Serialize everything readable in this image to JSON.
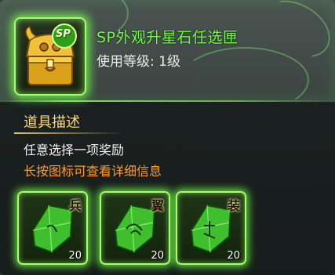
{
  "item": {
    "icon": "treasure-chest-sp-icon",
    "icon_badge": "SP",
    "name": "SP外观升星石任选匣",
    "level_text": "使用等级: 1级"
  },
  "description": {
    "section_title": "道具描述",
    "text": "任意选择一项奖励",
    "hint": "长按图标可查看详细信息"
  },
  "rewards": [
    {
      "icon": "green-crystal-icon",
      "char": "兵",
      "count": "20"
    },
    {
      "icon": "green-crystal-icon",
      "char": "翼",
      "count": "20"
    },
    {
      "icon": "green-crystal-icon",
      "char": "装",
      "count": "20"
    }
  ],
  "colors": {
    "title": "#6dff3d",
    "section_title": "#ffd86a",
    "hint": "#ff9a2a",
    "glow": "#a6ff6a"
  }
}
